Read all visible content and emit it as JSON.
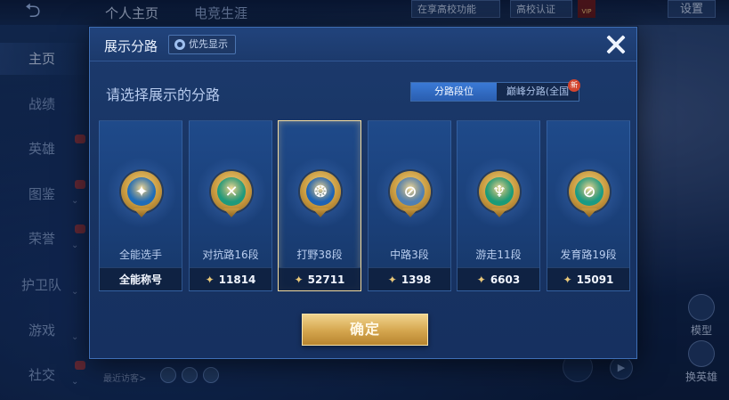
{
  "top": {
    "tabs": [
      "个人主页",
      "电竞生涯"
    ],
    "campus_feature": "在享高校功能",
    "campus_cert": "高校认证",
    "vip": "VIP",
    "settings": "设置"
  },
  "side_nav": {
    "items": [
      {
        "label": "主页",
        "active": true,
        "chev": false,
        "dot": false
      },
      {
        "label": "战绩",
        "active": false,
        "chev": false,
        "dot": false
      },
      {
        "label": "英雄",
        "active": false,
        "chev": false,
        "dot": true
      },
      {
        "label": "图鉴",
        "active": false,
        "chev": true,
        "dot": true
      },
      {
        "label": "荣誉",
        "active": false,
        "chev": true,
        "dot": true
      },
      {
        "label": "护卫队",
        "active": false,
        "chev": true,
        "dot": false
      },
      {
        "label": "游戏",
        "active": false,
        "chev": true,
        "dot": false
      },
      {
        "label": "社交",
        "active": false,
        "chev": true,
        "dot": true
      }
    ]
  },
  "footer": {
    "recent_visitors": "最近访客>"
  },
  "right_tools": {
    "model": "模型",
    "change_hero": "换英雄"
  },
  "modal": {
    "title": "展示分路",
    "priority_label": "优先显示",
    "section_title": "请选择展示的分路",
    "toggle": {
      "option1": "分路段位",
      "option2": "巅峰分路(全国",
      "new_badge": "新"
    },
    "cards": [
      {
        "label": "全能选手",
        "value": "全能称号",
        "icon": "all-round-emblem-icon",
        "glyph": "✦",
        "inner": "#1f6cb8",
        "selected": false,
        "show_star": false
      },
      {
        "label": "对抗路16段",
        "value": "11814",
        "icon": "clash-lane-emblem-icon",
        "glyph": "✕",
        "inner": "#1e9a7c",
        "selected": false,
        "show_star": true
      },
      {
        "label": "打野38段",
        "value": "52711",
        "icon": "jungle-emblem-icon",
        "glyph": "❂",
        "inner": "#1c62b5",
        "selected": true,
        "show_star": true
      },
      {
        "label": "中路3段",
        "value": "1398",
        "icon": "mid-lane-emblem-icon",
        "glyph": "⊘",
        "inner": "#4f7fb3",
        "selected": false,
        "show_star": true
      },
      {
        "label": "游走11段",
        "value": "6603",
        "icon": "roam-emblem-icon",
        "glyph": "♆",
        "inner": "#1a9b78",
        "selected": false,
        "show_star": true
      },
      {
        "label": "发育路19段",
        "value": "15091",
        "icon": "farm-lane-emblem-icon",
        "glyph": "⊘",
        "inner": "#1a9b84",
        "selected": false,
        "show_star": true
      }
    ],
    "confirm_label": "确定"
  }
}
